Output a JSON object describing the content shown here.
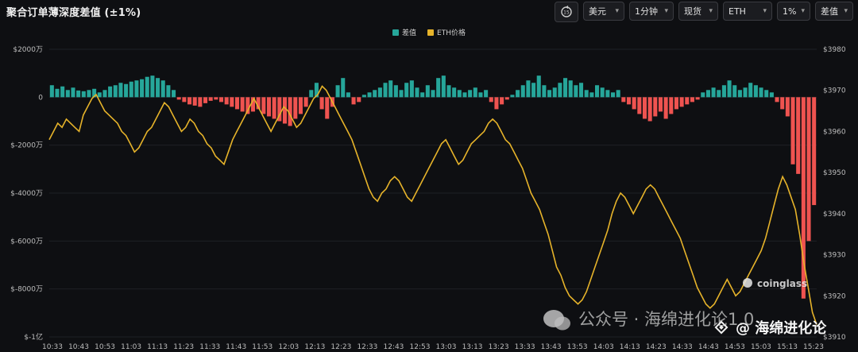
{
  "header": {
    "title": "聚合订单薄深度差值 (±1%)",
    "dropdowns": [
      {
        "name": "currency",
        "value": "美元"
      },
      {
        "name": "interval",
        "value": "1分钟"
      },
      {
        "name": "market",
        "value": "现货"
      },
      {
        "name": "symbol",
        "value": "ETH"
      },
      {
        "name": "depth",
        "value": "1%"
      },
      {
        "name": "metric",
        "value": "差值"
      }
    ],
    "icon": "rotate-15-icon"
  },
  "watermark": {
    "brand": "coinglass",
    "wechat": "公众号 · 海绵进化论1.0",
    "binance": "@ 海绵进化论"
  },
  "colors": {
    "positive": "#26a69a",
    "negative": "#ef5350",
    "price": "#e6b32a",
    "background": "#0e0f12"
  },
  "chart_data": {
    "type": "bar",
    "legend": [
      "差值",
      "ETH价格"
    ],
    "y_left": {
      "range": [
        -100000000,
        20000000
      ],
      "ticks": [
        "$2000万",
        "0",
        "$-2000万",
        "$-4000万",
        "$-6000万",
        "$-8000万",
        "$-1亿"
      ]
    },
    "y_right": {
      "range": [
        3910,
        3980
      ],
      "ticks": [
        "$3980",
        "$3970",
        "$3960",
        "$3950",
        "$3940",
        "$3930",
        "$3920",
        "$3910"
      ]
    },
    "x_ticks": [
      "10:33",
      "10:43",
      "10:53",
      "11:03",
      "11:13",
      "11:23",
      "11:33",
      "11:43",
      "11:53",
      "12:03",
      "12:13",
      "12:23",
      "12:33",
      "12:43",
      "12:53",
      "13:03",
      "13:13",
      "13:23",
      "13:33",
      "13:43",
      "13:53",
      "14:03",
      "14:13",
      "14:23",
      "14:33",
      "14:43",
      "14:53",
      "15:03",
      "15:13",
      "15:23"
    ],
    "diff_series_wan": [
      500,
      350,
      450,
      300,
      400,
      280,
      250,
      300,
      350,
      200,
      300,
      450,
      500,
      600,
      550,
      650,
      700,
      750,
      850,
      900,
      800,
      700,
      500,
      300,
      -100,
      -200,
      -300,
      -350,
      -400,
      -250,
      -150,
      -100,
      -200,
      -300,
      -400,
      -500,
      -600,
      -700,
      -600,
      -500,
      -700,
      -800,
      -900,
      -1000,
      -1100,
      -1200,
      -900,
      -700,
      -400,
      300,
      600,
      -500,
      -900,
      -400,
      500,
      800,
      200,
      -300,
      -200,
      100,
      200,
      300,
      400,
      600,
      700,
      500,
      300,
      600,
      700,
      400,
      200,
      500,
      300,
      800,
      900,
      500,
      400,
      300,
      200,
      300,
      400,
      200,
      300,
      -200,
      -500,
      -300,
      -100,
      100,
      300,
      500,
      700,
      600,
      900,
      500,
      300,
      400,
      600,
      800,
      700,
      500,
      600,
      300,
      200,
      500,
      400,
      300,
      200,
      300,
      -200,
      -300,
      -500,
      -700,
      -900,
      -1000,
      -800,
      -600,
      -900,
      -700,
      -500,
      -400,
      -300,
      -200,
      -100,
      200,
      300,
      400,
      300,
      500,
      700,
      500,
      300,
      400,
      600,
      500,
      400,
      300,
      200,
      -200,
      -500,
      -800,
      -2800,
      -3200,
      -8400,
      -6000,
      -4500
    ],
    "price_series": [
      3958,
      3960,
      3962,
      3961,
      3963,
      3962,
      3961,
      3960,
      3964,
      3966,
      3968,
      3969,
      3967,
      3965,
      3964,
      3963,
      3962,
      3960,
      3959,
      3957,
      3955,
      3956,
      3958,
      3960,
      3961,
      3963,
      3965,
      3967,
      3966,
      3964,
      3962,
      3960,
      3961,
      3963,
      3962,
      3960,
      3959,
      3957,
      3956,
      3954,
      3953,
      3952,
      3955,
      3958,
      3960,
      3962,
      3964,
      3966,
      3968,
      3966,
      3964,
      3962,
      3960,
      3962,
      3964,
      3966,
      3965,
      3963,
      3961,
      3962,
      3964,
      3966,
      3968,
      3969,
      3971,
      3970,
      3968,
      3966,
      3964,
      3962,
      3960,
      3958,
      3955,
      3952,
      3949,
      3946,
      3944,
      3943,
      3945,
      3946,
      3948,
      3949,
      3948,
      3946,
      3944,
      3943,
      3945,
      3947,
      3949,
      3951,
      3953,
      3955,
      3957,
      3958,
      3956,
      3954,
      3952,
      3953,
      3955,
      3957,
      3958,
      3959,
      3960,
      3962,
      3963,
      3962,
      3960,
      3958,
      3957,
      3955,
      3953,
      3951,
      3948,
      3945,
      3943,
      3941,
      3938,
      3935,
      3931,
      3927,
      3925,
      3922,
      3920,
      3919,
      3918,
      3919,
      3921,
      3924,
      3927,
      3930,
      3933,
      3936,
      3940,
      3943,
      3945,
      3944,
      3942,
      3940,
      3942,
      3944,
      3946,
      3947,
      3946,
      3944,
      3942,
      3940,
      3938,
      3936,
      3934,
      3931,
      3928,
      3925,
      3922,
      3920,
      3918,
      3917,
      3918,
      3920,
      3922,
      3924,
      3922,
      3920,
      3921,
      3923,
      3925,
      3927,
      3929,
      3931,
      3934,
      3938,
      3942,
      3946,
      3949,
      3947,
      3944,
      3941,
      3935,
      3928,
      3922,
      3916,
      3913
    ]
  }
}
